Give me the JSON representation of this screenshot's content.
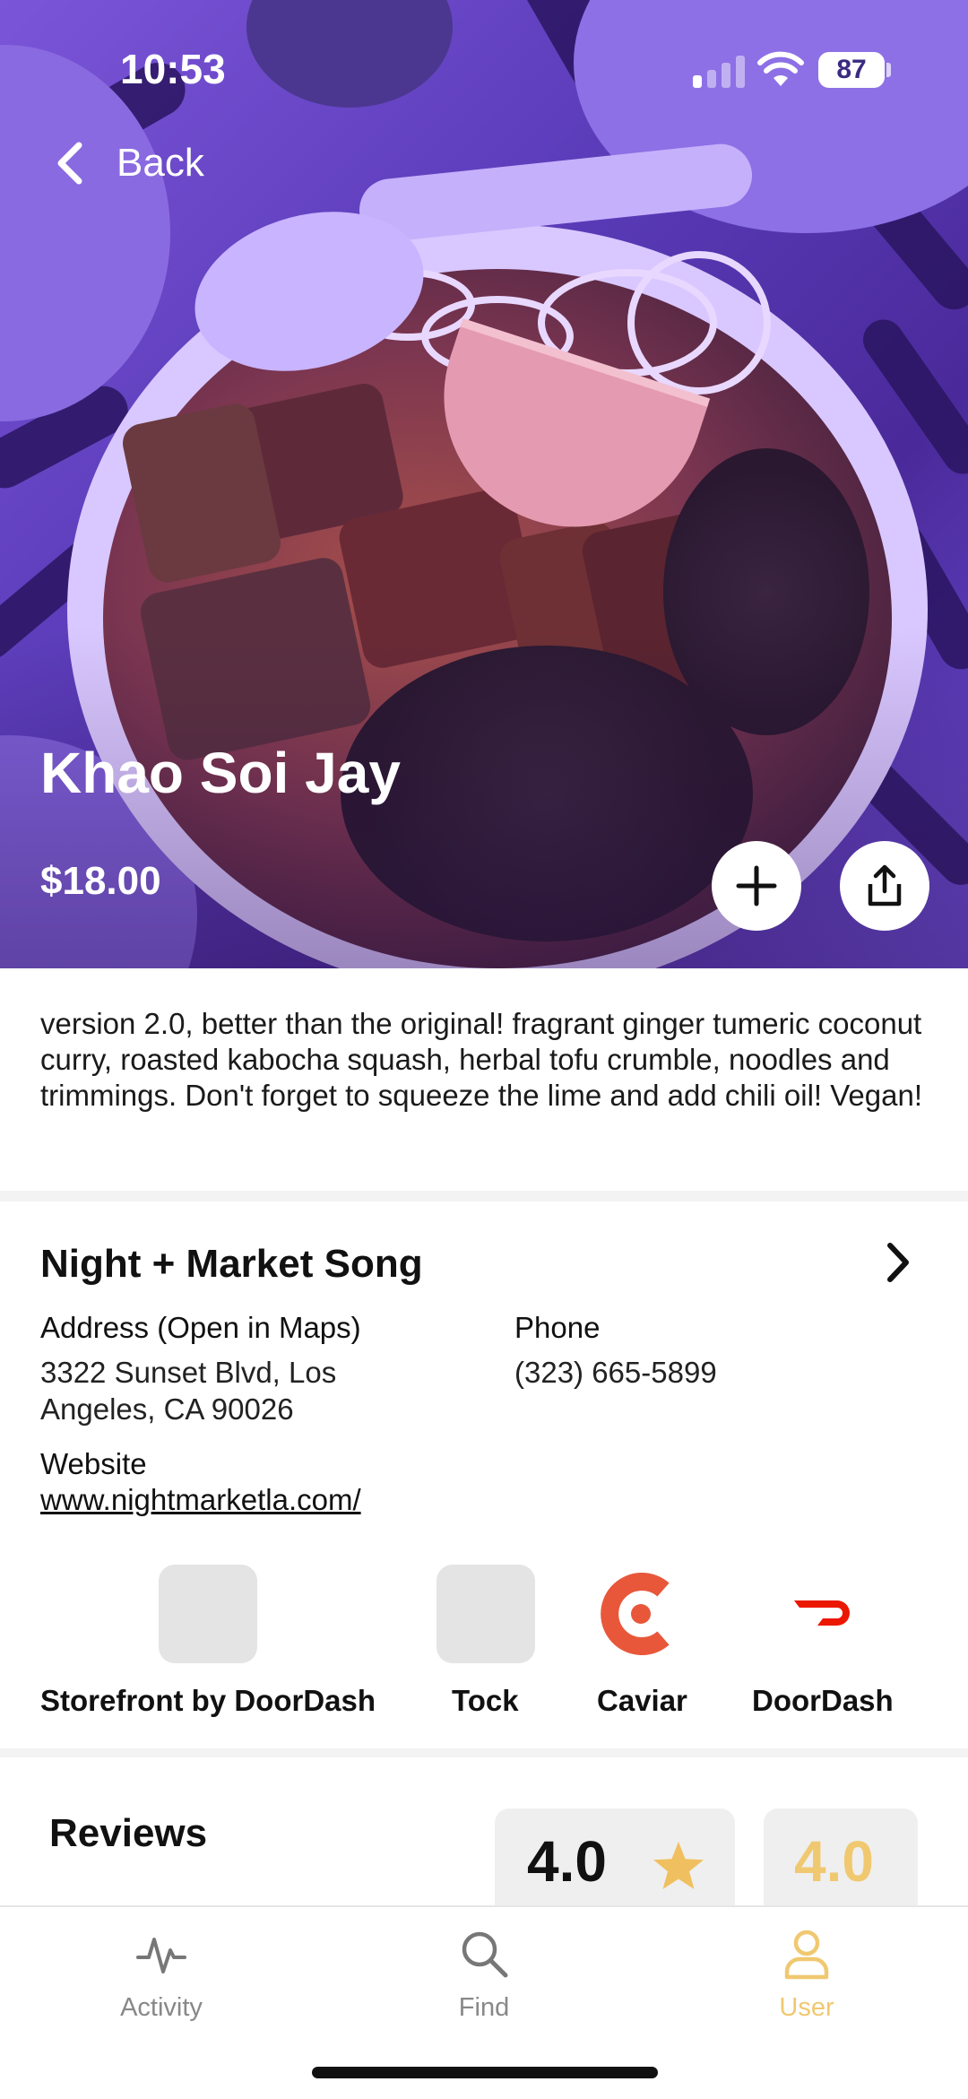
{
  "status_bar": {
    "time": "10:53",
    "battery": "87"
  },
  "nav": {
    "back_label": "Back"
  },
  "dish": {
    "title": "Khao Soi Jay",
    "price": "$18.00",
    "description": "version 2.0, better than the original! fragrant ginger tumeric coconut curry, roasted kabocha squash, herbal tofu crumble, noodles and trimmings. Don't forget to squeeze the lime and add chili oil! Vegan!"
  },
  "restaurant": {
    "name": "Night + Market Song",
    "address_label": "Address (Open in Maps)",
    "address_line1": "3322 Sunset Blvd, Los",
    "address_line2": "Angeles, CA 90026",
    "phone_label": "Phone",
    "phone": "(323) 665-5899",
    "website_label": "Website",
    "website": "www.nightmarketla.com/"
  },
  "services": [
    {
      "label": "Storefront by DoorDash",
      "icon": "placeholder-icon"
    },
    {
      "label": "Tock",
      "icon": "placeholder-icon"
    },
    {
      "label": "Caviar",
      "icon": "caviar-logo",
      "color": "#e8573a"
    },
    {
      "label": "DoorDash",
      "icon": "doordash-logo",
      "color": "#eb1700"
    }
  ],
  "reviews": {
    "title": "Reviews",
    "ratings": [
      {
        "value": "4.0",
        "color": "#111111",
        "star_color": "#f0c060"
      },
      {
        "value": "4.0",
        "color": "#f0c870"
      }
    ]
  },
  "tabs": [
    {
      "label": "Activity",
      "icon": "activity-icon",
      "active": false
    },
    {
      "label": "Find",
      "icon": "search-icon",
      "active": false
    },
    {
      "label": "User",
      "icon": "user-icon",
      "active": true
    }
  ],
  "colors": {
    "accent": "#f0c870",
    "inactive_tab": "#888888"
  }
}
